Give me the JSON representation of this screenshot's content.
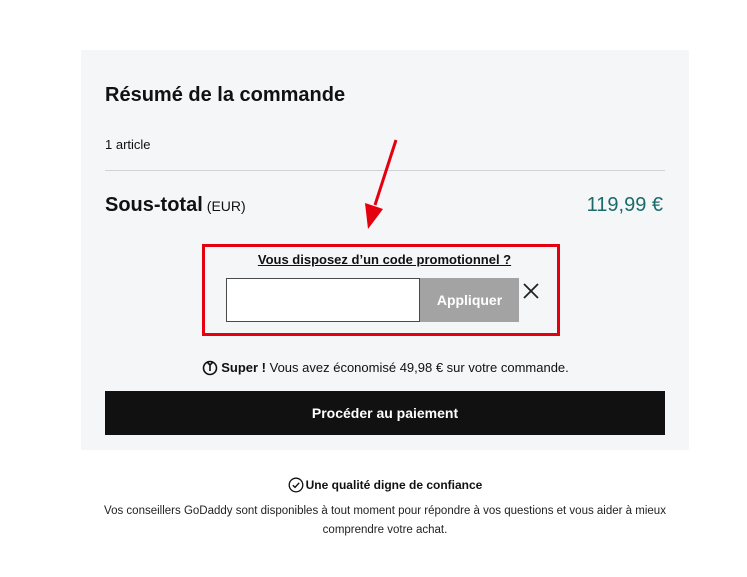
{
  "summary": {
    "title": "Résumé de la commande",
    "item_count": "1 article",
    "subtotal_label": "Sous-total",
    "subtotal_currency": "(EUR)",
    "subtotal_value": "119,99 €"
  },
  "promo": {
    "link_label": "Vous disposez d’un code promotionnel ?",
    "input_value": "",
    "input_placeholder": "",
    "apply_label": "Appliquer"
  },
  "savings": {
    "highlight": "Super !",
    "message": " Vous avez économisé 49,98 € sur votre commande."
  },
  "checkout": {
    "button_label": "Procéder au paiement"
  },
  "trust": {
    "title": "Une qualité digne de confiance",
    "text": "Vos conseillers GoDaddy sont disponibles à tout moment pour répondre à vos questions et vous aider à mieux comprendre votre achat."
  },
  "colors": {
    "annotation_red": "#e4000f",
    "subtotal_teal": "#1b6b6b",
    "card_background": "#f5f6f7",
    "checkout_black": "#111111",
    "apply_disabled_gray": "#a3a3a3"
  }
}
